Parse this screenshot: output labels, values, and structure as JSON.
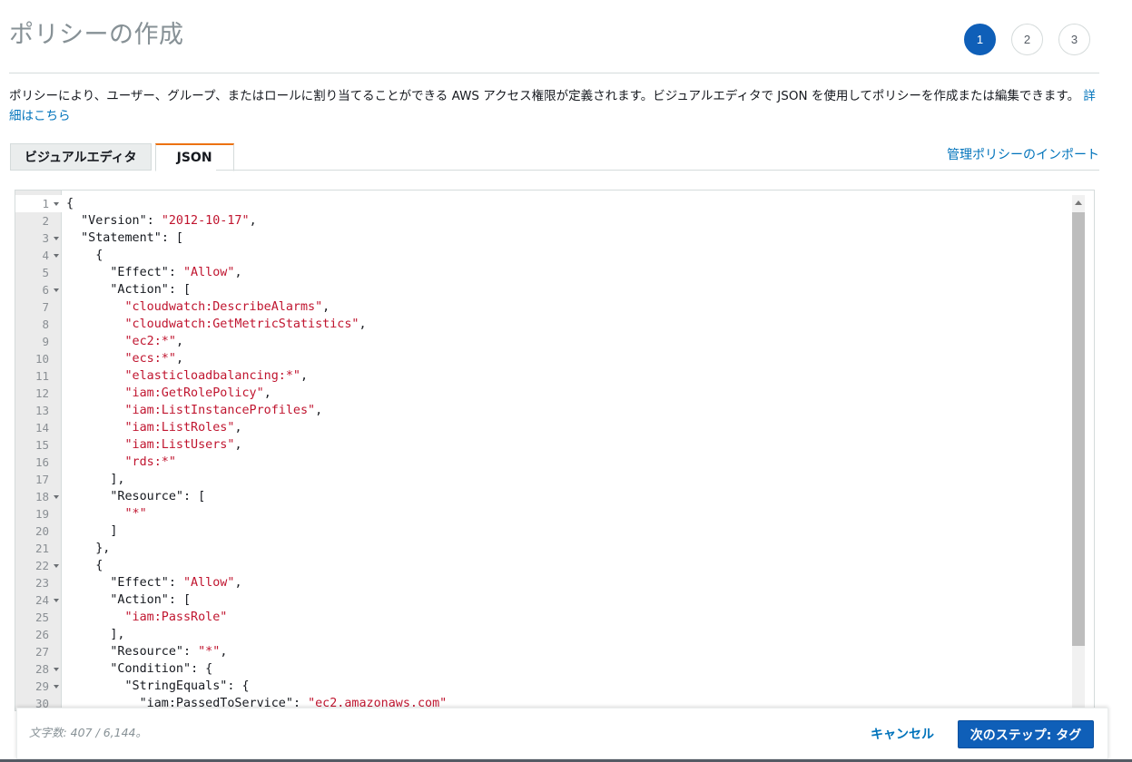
{
  "page": {
    "title": "ポリシーの作成",
    "steps": [
      "1",
      "2",
      "3"
    ],
    "active_step": "1",
    "description": "ポリシーにより、ユーザー、グループ、またはロールに割り当てることができる AWS アクセス権限が定義されます。ビジュアルエディタで JSON を使用してポリシーを作成または編集できます。",
    "learn_more": "詳細はこちら"
  },
  "tabs": [
    {
      "label": "ビジュアルエディタ",
      "active": false
    },
    {
      "label": "JSON",
      "active": true
    }
  ],
  "import_link": "管理ポリシーのインポート",
  "editor": {
    "lines": [
      {
        "n": "1",
        "fold": true,
        "text": "{"
      },
      {
        "n": "2",
        "fold": false,
        "text": "  \"Version\": \"2012-10-17\","
      },
      {
        "n": "3",
        "fold": true,
        "text": "  \"Statement\": ["
      },
      {
        "n": "4",
        "fold": true,
        "text": "    {"
      },
      {
        "n": "5",
        "fold": false,
        "text": "      \"Effect\": \"Allow\","
      },
      {
        "n": "6",
        "fold": true,
        "text": "      \"Action\": ["
      },
      {
        "n": "7",
        "fold": false,
        "text": "        \"cloudwatch:DescribeAlarms\","
      },
      {
        "n": "8",
        "fold": false,
        "text": "        \"cloudwatch:GetMetricStatistics\","
      },
      {
        "n": "9",
        "fold": false,
        "text": "        \"ec2:*\","
      },
      {
        "n": "10",
        "fold": false,
        "text": "        \"ecs:*\","
      },
      {
        "n": "11",
        "fold": false,
        "text": "        \"elasticloadbalancing:*\","
      },
      {
        "n": "12",
        "fold": false,
        "text": "        \"iam:GetRolePolicy\","
      },
      {
        "n": "13",
        "fold": false,
        "text": "        \"iam:ListInstanceProfiles\","
      },
      {
        "n": "14",
        "fold": false,
        "text": "        \"iam:ListRoles\","
      },
      {
        "n": "15",
        "fold": false,
        "text": "        \"iam:ListUsers\","
      },
      {
        "n": "16",
        "fold": false,
        "text": "        \"rds:*\""
      },
      {
        "n": "17",
        "fold": false,
        "text": "      ],"
      },
      {
        "n": "18",
        "fold": true,
        "text": "      \"Resource\": ["
      },
      {
        "n": "19",
        "fold": false,
        "text": "        \"*\""
      },
      {
        "n": "20",
        "fold": false,
        "text": "      ]"
      },
      {
        "n": "21",
        "fold": false,
        "text": "    },"
      },
      {
        "n": "22",
        "fold": true,
        "text": "    {"
      },
      {
        "n": "23",
        "fold": false,
        "text": "      \"Effect\": \"Allow\","
      },
      {
        "n": "24",
        "fold": true,
        "text": "      \"Action\": ["
      },
      {
        "n": "25",
        "fold": false,
        "text": "        \"iam:PassRole\""
      },
      {
        "n": "26",
        "fold": false,
        "text": "      ],"
      },
      {
        "n": "27",
        "fold": false,
        "text": "      \"Resource\": \"*\","
      },
      {
        "n": "28",
        "fold": true,
        "text": "      \"Condition\": {"
      },
      {
        "n": "29",
        "fold": true,
        "text": "        \"StringEquals\": {"
      },
      {
        "n": "30",
        "fold": false,
        "text": "          \"iam:PassedToService\": \"ec2.amazonaws.com\""
      }
    ]
  },
  "footer": {
    "char_count": "文字数: 407 / 6,144。",
    "cancel_label": "キャンセル",
    "next_label": "次のステップ: タグ"
  },
  "colors": {
    "accent": "#0f5fb8",
    "tab_highlight": "#ec7211",
    "link": "#0073bb",
    "string": "#c0152f"
  }
}
